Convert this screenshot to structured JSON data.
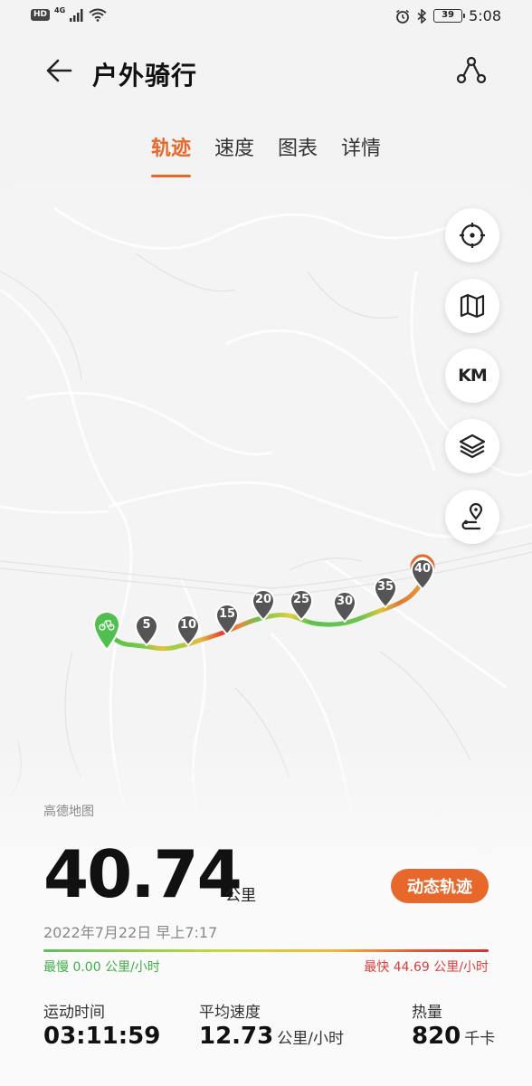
{
  "status_bar": {
    "hd": "HD",
    "network": "4G",
    "battery": "39",
    "time": "5:08"
  },
  "header": {
    "title": "户外骑行"
  },
  "tabs": [
    {
      "label": "轨迹",
      "active": true
    },
    {
      "label": "速度",
      "active": false
    },
    {
      "label": "图表",
      "active": false
    },
    {
      "label": "详情",
      "active": false
    }
  ],
  "map": {
    "buttons": [
      "locate-icon",
      "map-icon",
      "KM",
      "layers-icon",
      "route-pin-icon"
    ],
    "km_label": "KM",
    "attribution": "高德地图",
    "km_markers": [
      "5",
      "10",
      "15",
      "20",
      "25",
      "30",
      "35",
      "40"
    ]
  },
  "stats": {
    "distance": "40.74",
    "distance_unit": "公里",
    "dynamic_track": "动态轨迹",
    "date": "2022年7月22日 早上7:17",
    "slowest": "最慢 0.00 公里/小时",
    "fastest": "最快 44.69 公里/小时",
    "duration_label": "运动时间",
    "duration_value": "03:11:59",
    "avg_speed_label": "平均速度",
    "avg_speed_value": "12.73",
    "avg_speed_unit": "公里/小时",
    "calories_label": "热量",
    "calories_value": "820",
    "calories_unit": "千卡"
  },
  "colors": {
    "accent": "#e8682c",
    "slow": "#3fae49",
    "fast": "#d9403a"
  }
}
